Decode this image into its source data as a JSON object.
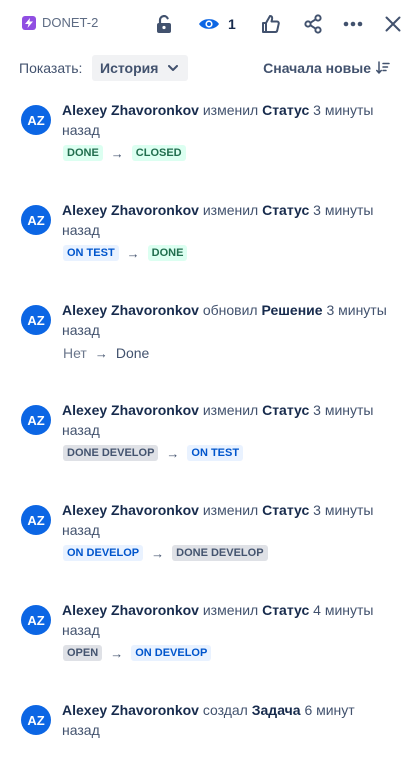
{
  "header": {
    "issue_key": "DONET-2",
    "watch_count": "1",
    "colors": {
      "issue_type": "#904ee2",
      "watch_icon": "#0c66e4",
      "icon": "#42526e"
    }
  },
  "filter": {
    "show_label": "Показать:",
    "selected": "История",
    "sort_label": "Сначала новые"
  },
  "history": [
    {
      "avatar": "AZ",
      "author": "Alexey Zhavoronkov",
      "action": "изменил",
      "field": "Статус",
      "time": "3 минуты назад",
      "from": "DONE",
      "to": "CLOSED",
      "from_style": "green",
      "to_style": "green"
    },
    {
      "avatar": "AZ",
      "author": "Alexey Zhavoronkov",
      "action": "изменил",
      "field": "Статус",
      "time": "3 минуты назад",
      "from": "ON TEST",
      "to": "DONE",
      "from_style": "blue",
      "to_style": "green"
    },
    {
      "avatar": "AZ",
      "author": "Alexey Zhavoronkov",
      "action": "обновил",
      "field": "Решение",
      "time": "3 минуты назад",
      "from": "Нет",
      "to": "Done",
      "from_style": "plain",
      "to_style": "plain"
    },
    {
      "avatar": "AZ",
      "author": "Alexey Zhavoronkov",
      "action": "изменил",
      "field": "Статус",
      "time": "3 минуты назад",
      "from": "DONE DEVELOP",
      "to": "ON TEST",
      "from_style": "gray",
      "to_style": "blue"
    },
    {
      "avatar": "AZ",
      "author": "Alexey Zhavoronkov",
      "action": "изменил",
      "field": "Статус",
      "time": "3 минуты назад",
      "from": "ON DEVELOP",
      "to": "DONE DEVELOP",
      "from_style": "blue",
      "to_style": "gray"
    },
    {
      "avatar": "AZ",
      "author": "Alexey Zhavoronkov",
      "action": "изменил",
      "field": "Статус",
      "time": "4 минуты назад",
      "from": "OPEN",
      "to": "ON DEVELOP",
      "from_style": "gray",
      "to_style": "blue"
    },
    {
      "avatar": "AZ",
      "author": "Alexey Zhavoronkov",
      "action": "создал",
      "field": "Задача",
      "time": "6 минут назад"
    }
  ]
}
